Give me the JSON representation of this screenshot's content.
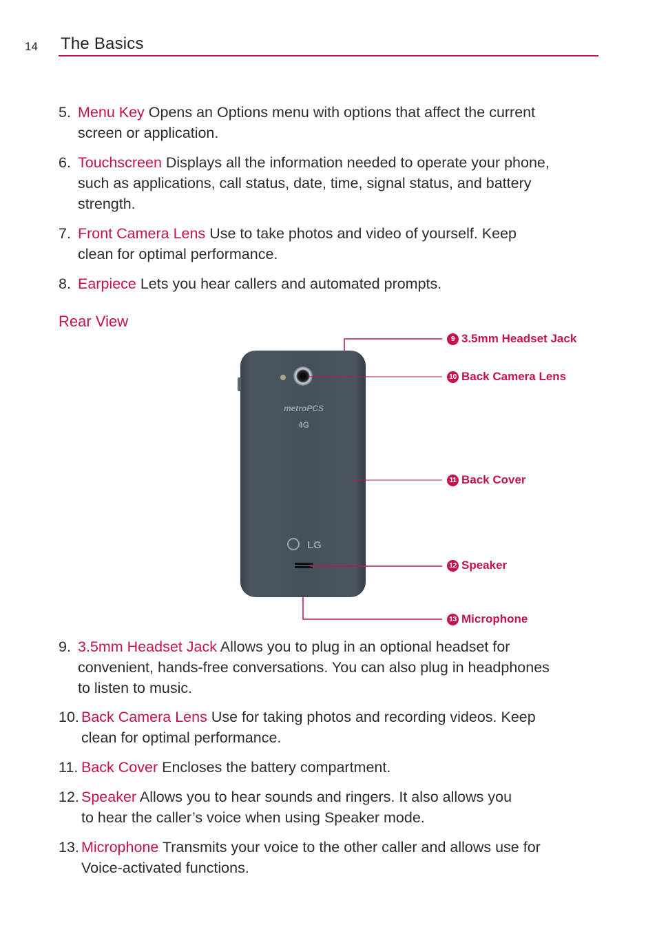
{
  "header": {
    "page_number": "14",
    "title": "The Basics"
  },
  "items_top": [
    {
      "number": "5.",
      "term": "Menu Key",
      "line1": " Opens an Options menu with options that affect the current",
      "line2": "screen or application."
    },
    {
      "number": "6.",
      "term": "Touchscreen",
      "line1": " Displays all the information needed to operate your phone,",
      "line2": "such as applications, call status, date, time, signal status, and battery",
      "line3": "strength."
    },
    {
      "number": "7.",
      "term": "Front Camera Lens",
      "line1": " Use to take photos and video of yourself. Keep",
      "line2": "clean for optimal performance."
    },
    {
      "number": "8.",
      "term": "Earpiece",
      "line1": " Lets you hear callers and automated prompts."
    }
  ],
  "section": {
    "heading": "Rear View"
  },
  "diagram": {
    "phone_brand": "metroPCS",
    "phone_network": "4G",
    "phone_logo": "LG",
    "callouts": [
      {
        "badge": "9",
        "label": "3.5mm Headset Jack"
      },
      {
        "badge": "10",
        "label": "Back Camera Lens"
      },
      {
        "badge": "11",
        "label": "Back Cover"
      },
      {
        "badge": "12",
        "label": "Speaker"
      },
      {
        "badge": "13",
        "label": "Microphone"
      }
    ],
    "accent_color": "#c3124f"
  },
  "items_bottom": [
    {
      "number": "9.",
      "term": "3.5mm Headset Jack",
      "line1": " Allows you to plug in an optional headset for",
      "line2": "convenient, hands-free conversations. You can also plug in headphones",
      "line3": "to listen to music."
    },
    {
      "number": "10.",
      "term": "Back Camera Lens",
      "line1": " Use for taking photos and recording videos. Keep",
      "line2": "clean for optimal performance."
    },
    {
      "number": "11.",
      "term": "Back Cover",
      "line1": " Encloses the battery compartment."
    },
    {
      "number": "12.",
      "term": "Speaker",
      "line1": " Allows you to hear sounds and ringers. It also allows you",
      "line2": "to hear the caller’s voice when using Speaker mode."
    },
    {
      "number": "13.",
      "term": "Microphone",
      "line1": " Transmits your voice to the other caller and allows use for",
      "line2": "Voice-activated functions."
    }
  ]
}
